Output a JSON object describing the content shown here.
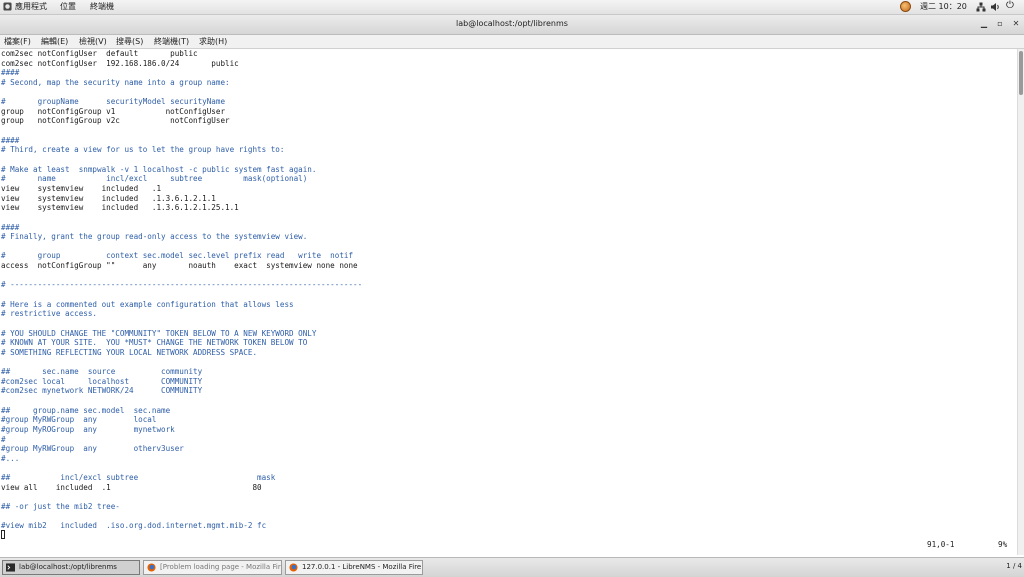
{
  "top_bar": {
    "applications": "應用程式",
    "places": "位置",
    "terminal": "終端機",
    "clock": "週二 10：20",
    "icons": [
      "applications-icon",
      "user-avatar",
      "network-icon",
      "volume-icon",
      "power-icon"
    ]
  },
  "window": {
    "title": "lab@localhost:/opt/librenms"
  },
  "menu": [
    "檔案(F)",
    "編輯(E)",
    "檢視(V)",
    "搜尋(S)",
    "終端機(T)",
    "求助(H)"
  ],
  "colors": {
    "comment": "#2f5fa8",
    "text": "#1a1a1a"
  },
  "terminal": {
    "lines": [
      "com2sec notConfigUser  default       public",
      "com2sec notConfigUser  192.168.186.0/24       public",
      "####",
      "# Second, map the security name into a group name:",
      "",
      "#       groupName      securityModel securityName",
      "group   notConfigGroup v1           notConfigUser",
      "group   notConfigGroup v2c           notConfigUser",
      "",
      "####",
      "# Third, create a view for us to let the group have rights to:",
      "",
      "# Make at least  snmpwalk -v 1 localhost -c public system fast again.",
      "#       name           incl/excl     subtree         mask(optional)",
      "view    systemview    included   .1",
      "view    systemview    included   .1.3.6.1.2.1.1",
      "view    systemview    included   .1.3.6.1.2.1.25.1.1",
      "",
      "####",
      "# Finally, grant the group read-only access to the systemview view.",
      "",
      "#       group          context sec.model sec.level prefix read   write  notif",
      "access  notConfigGroup \"\"      any       noauth    exact  systemview none none",
      "",
      "# -----------------------------------------------------------------------------",
      "",
      "# Here is a commented out example configuration that allows less",
      "# restrictive access.",
      "",
      "# YOU SHOULD CHANGE THE \"COMMUNITY\" TOKEN BELOW TO A NEW KEYWORD ONLY",
      "# KNOWN AT YOUR SITE.  YOU *MUST* CHANGE THE NETWORK TOKEN BELOW TO",
      "# SOMETHING REFLECTING YOUR LOCAL NETWORK ADDRESS SPACE.",
      "",
      "##       sec.name  source          community",
      "#com2sec local     localhost       COMMUNITY",
      "#com2sec mynetwork NETWORK/24      COMMUNITY",
      "",
      "##     group.name sec.model  sec.name",
      "#group MyRWGroup  any        local",
      "#group MyROGroup  any        mynetwork",
      "#",
      "#group MyRWGroup  any        otherv3user",
      "#...",
      "",
      "##           incl/excl subtree                          mask",
      "view all    included  .1                               80",
      "",
      "## -or just the mib2 tree-",
      "",
      "#view mib2   included  .iso.org.dod.internet.mgmt.mib-2 fc"
    ],
    "cursor_position": "91,0-1",
    "scroll_percent": "9%"
  },
  "taskbar": {
    "tasks": [
      {
        "label": "lab@localhost:/opt/librenms",
        "icon": "terminal-icon"
      },
      {
        "label": "[Problem loading page - Mozilla Fire···",
        "icon": "firefox-icon"
      },
      {
        "label": "127.0.0.1 - LibreNMS - Mozilla Fire···",
        "icon": "firefox-icon"
      }
    ],
    "workspace": "1 / 4"
  }
}
